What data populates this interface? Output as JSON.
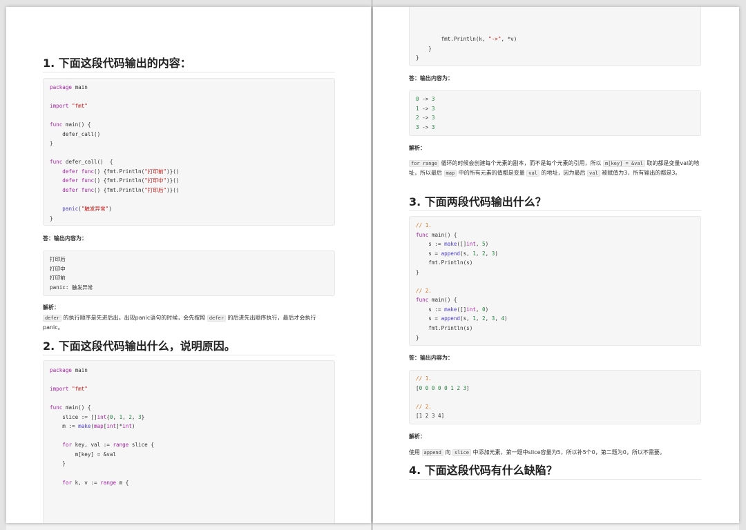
{
  "left": {
    "q1": {
      "heading": "1. 下面这段代码输出的内容：",
      "code": {
        "l1_kw": "package",
        "l1_rest": " main",
        "l2_kw": "import",
        "l2_str": "\"fmt\"",
        "l3_kw": "func",
        "l3_rest": " main() {",
        "l4": "    defer_call()",
        "l5": "}",
        "l6_kw": "func",
        "l6_rest": " defer_call()  {",
        "l7_kw": "defer",
        "l7_kw2": "func",
        "l7_a": "() {fmt.Println(",
        "l7_str": "\"打印前\"",
        "l7_b": ")}()",
        "l8_kw": "defer",
        "l8_kw2": "func",
        "l8_a": "() {fmt.Println(",
        "l8_str": "\"打印中\"",
        "l8_b": ")}()",
        "l9_kw": "defer",
        "l9_kw2": "func",
        "l9_a": "() {fmt.Println(",
        "l9_str": "\"打印后\"",
        "l9_b": ")}()",
        "l10_fn": "panic",
        "l10_str": "\"触发异常\"",
        "l11": "}"
      },
      "answer_label": "答：输出内容为：",
      "output": [
        "打印后",
        "打印中",
        "打印前",
        "panic: 触发异常"
      ],
      "analysis_label": "解析：",
      "analysis": {
        "code1": "defer",
        "t1": " 的执行顺序是先进后出。出现panic语句的时候，会先按照 ",
        "code2": "defer",
        "t2": " 的后进先出顺序执行，最后才会执行panic。"
      }
    },
    "q2": {
      "heading": "2. 下面这段代码输出什么，说明原因。",
      "code": {
        "l1_kw": "package",
        "l1_rest": " main",
        "l2_kw": "import",
        "l2_str": "\"fmt\"",
        "l3_kw": "func",
        "l3_rest": " main() {",
        "l4_a": "    slice := []",
        "l4_kw": "int",
        "l4_b": "{",
        "l4_n0": "0",
        "l4_n1": "1",
        "l4_n2": "2",
        "l4_n3": "3",
        "l4_c": "}",
        "l5_a": "    m := ",
        "l5_fn": "make",
        "l5_b": "(",
        "l5_kw": "map",
        "l5_c": "[",
        "l5_kw2": "int",
        "l5_d": "]*",
        "l5_kw3": "int",
        "l5_e": ")",
        "l6_a": "    ",
        "l6_kw": "for",
        "l6_b": " key, val := ",
        "l6_kw2": "range",
        "l6_c": " slice {",
        "l7": "        m[key] = &val",
        "l8": "    }",
        "l9_a": "    ",
        "l9_kw": "for",
        "l9_b": " k, v := ",
        "l9_kw2": "range",
        "l9_c": " m {"
      }
    }
  },
  "right": {
    "q2_cont": {
      "code": {
        "l1_a": "        fmt.Println(k, ",
        "l1_str": "\"->\"",
        "l1_b": ", *v)",
        "l2": "    }",
        "l3": "}"
      },
      "answer_label": "答：输出内容为：",
      "output": [
        {
          "n": "0",
          "arrow": " -> ",
          "v": "3"
        },
        {
          "n": "1",
          "arrow": " -> ",
          "v": "3"
        },
        {
          "n": "2",
          "arrow": " -> ",
          "v": "3"
        },
        {
          "n": "3",
          "arrow": " -> ",
          "v": "3"
        }
      ],
      "analysis_label": "解析：",
      "analysis": {
        "c1": "for range",
        "t1": " 循环的时候会创建每个元素的副本，而不是每个元素的引用，所以 ",
        "c2": "m[key] = &val",
        "t2": " 取的都是变量val的地址，所以最后 ",
        "c3": "map",
        "t3": " 中的所有元素的值都是变量 ",
        "c4": "val",
        "t4": " 的地址，因为最后 ",
        "c5": "val",
        "t5": " 被赋值为3，所有输出的都是3。"
      }
    },
    "q3": {
      "heading": "3. 下面两段代码输出什么？",
      "code": {
        "c1": "// 1.",
        "f1_kw": "func",
        "f1_rest": " main() {",
        "a1_a": "    s := ",
        "a1_fn": "make",
        "a1_b": "([]",
        "a1_kw": "int",
        "a1_c": ", ",
        "a1_n": "5",
        "a1_d": ")",
        "a2_a": "    s = ",
        "a2_fn": "append",
        "a2_b": "(s, ",
        "a2_n1": "1",
        "a2_n2": "2",
        "a2_n3": "3",
        "a2_c": ")",
        "a3": "    fmt.Println(s)",
        "a4": "}",
        "c2": "// 2.",
        "f2_kw": "func",
        "f2_rest": " main() {",
        "b1_a": "    s := ",
        "b1_fn": "make",
        "b1_b": "([]",
        "b1_kw": "int",
        "b1_c": ", ",
        "b1_n": "0",
        "b1_d": ")",
        "b2_a": "    s = ",
        "b2_fn": "append",
        "b2_b": "(s, ",
        "b2_n1": "1",
        "b2_n2": "2",
        "b2_n3": "3",
        "b2_n4": "4",
        "b2_c": ")",
        "b3": "    fmt.Println(s)",
        "b4": "}"
      },
      "answer_label": "答：输出内容为：",
      "output": {
        "c1": "// 1.",
        "o1_a": "[",
        "o1_nums": "0 0 0 0 0 1 2 3",
        "o1_b": "]",
        "c2": "// 2.",
        "o2": "[1 2 3 4]"
      },
      "analysis_label": "解析：",
      "analysis": {
        "t0": "使用 ",
        "c1": "append",
        "t1": " 向 ",
        "c2": "slice",
        "t2": " 中添加元素，第一题中slice容量为5，所以补5个0，第二题为0，所以不需要。"
      }
    },
    "q4": {
      "heading": "4. 下面这段代码有什么缺陷？"
    }
  }
}
